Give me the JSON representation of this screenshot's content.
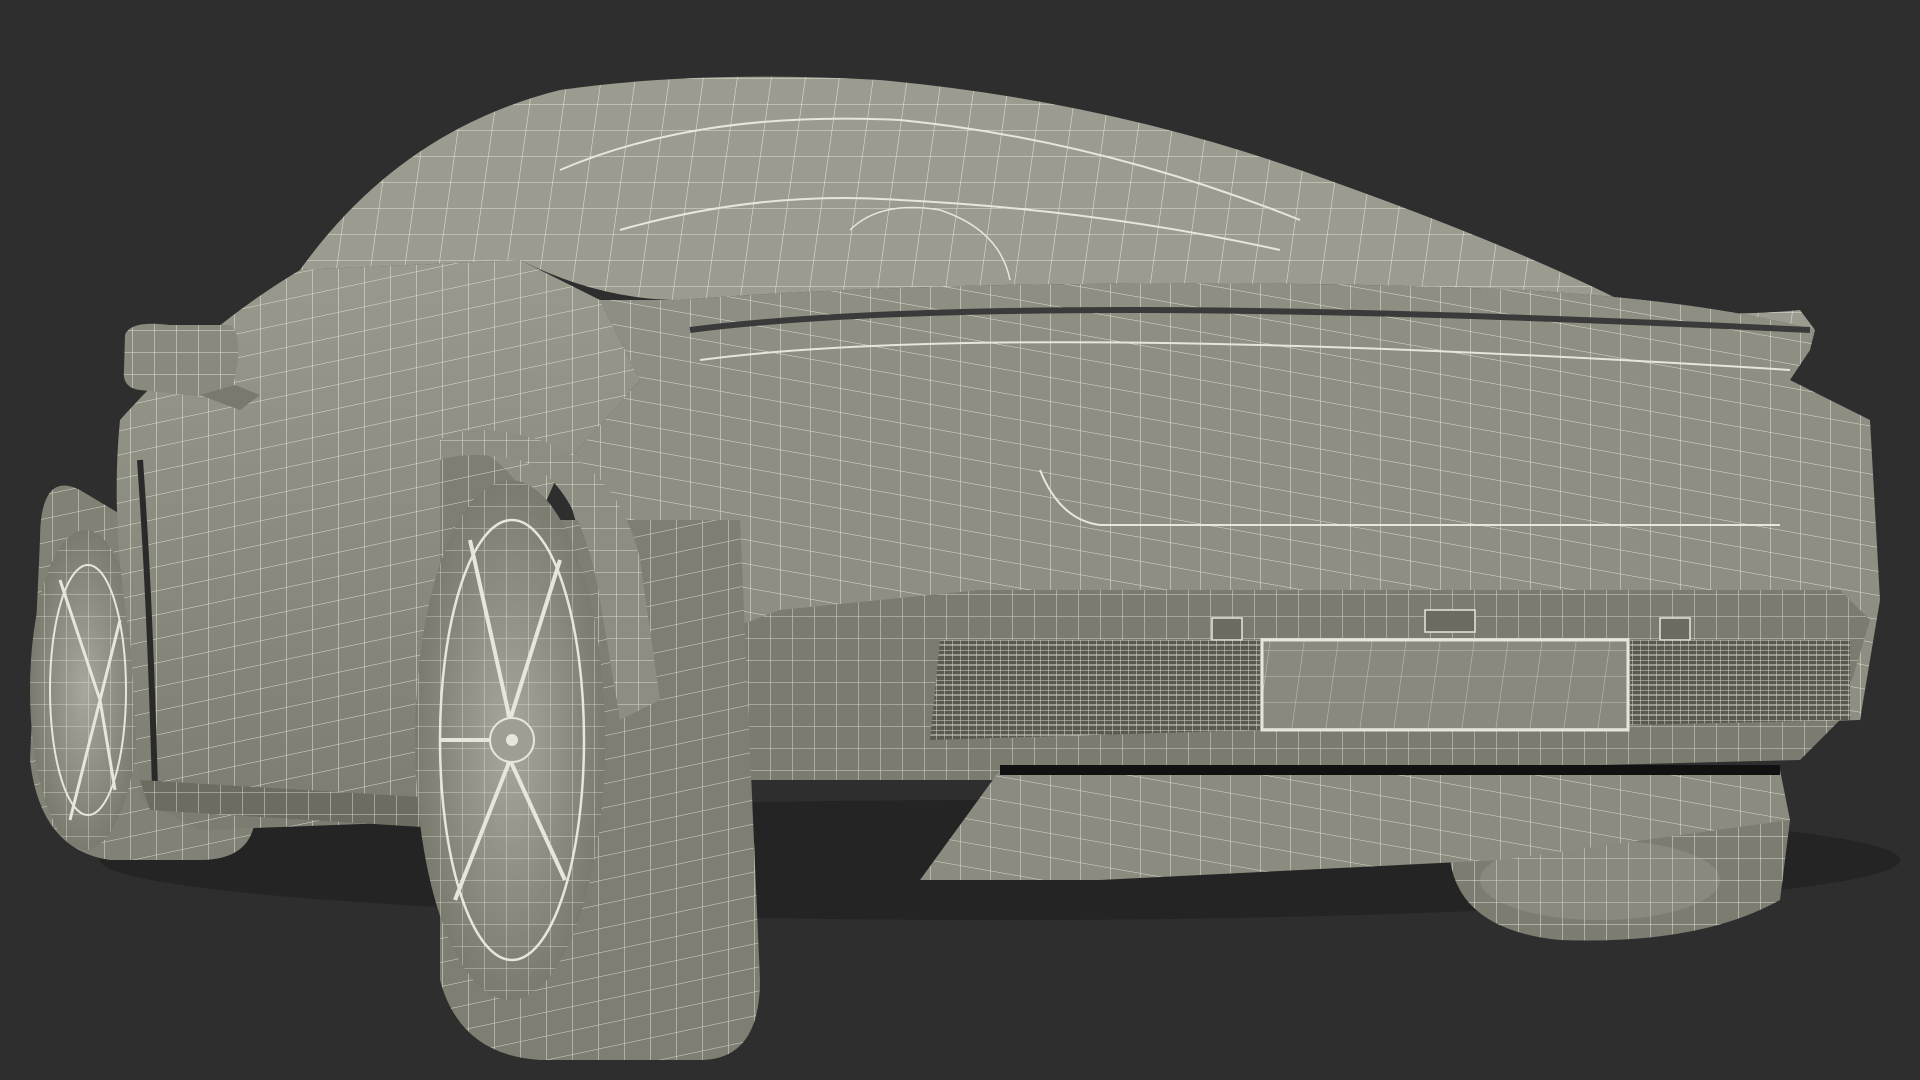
{
  "viewport": {
    "background": "#2e2e2e",
    "subject": "sports-car-wireframe-rear-three-quarter-view"
  },
  "colors": {
    "surface": "#8e8d80",
    "surface_light": "#a2a195",
    "surface_dark": "#6f6e63",
    "wire": "#e8e8dc",
    "shadow": "#1a1a1a",
    "wheel_face": "#9a998c"
  }
}
